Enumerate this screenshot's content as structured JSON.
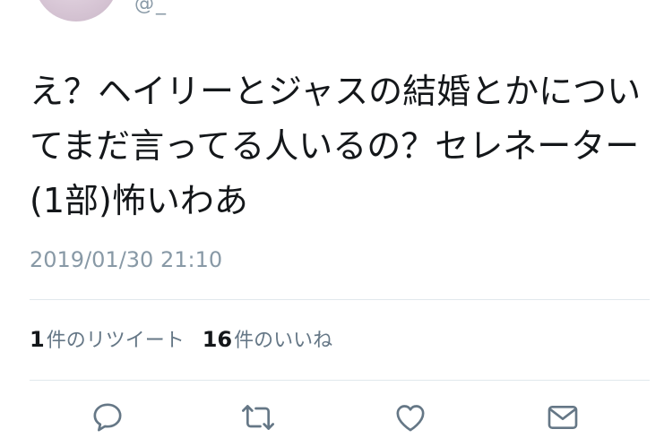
{
  "tweet": {
    "handle_fragment": "@_",
    "text": "え？ヘイリーとジャスの結婚とかについてまだ言ってる人いるの？セレネーター(1部)怖いわあ",
    "timestamp": "2019/01/30 21:10"
  },
  "stats": {
    "retweets_count": "1",
    "retweets_label": "件のリツイート",
    "likes_count": "16",
    "likes_label": "件のいいね"
  },
  "actions": [
    {
      "name": "reply",
      "icon": "speech-bubble-icon"
    },
    {
      "name": "retweet",
      "icon": "retweet-arrows-icon"
    },
    {
      "name": "like",
      "icon": "heart-icon"
    },
    {
      "name": "share",
      "icon": "envelope-icon"
    }
  ],
  "colors": {
    "text": "#14171a",
    "muted": "#8899a6",
    "icon": "#657786",
    "divider": "#e1e8ed"
  }
}
